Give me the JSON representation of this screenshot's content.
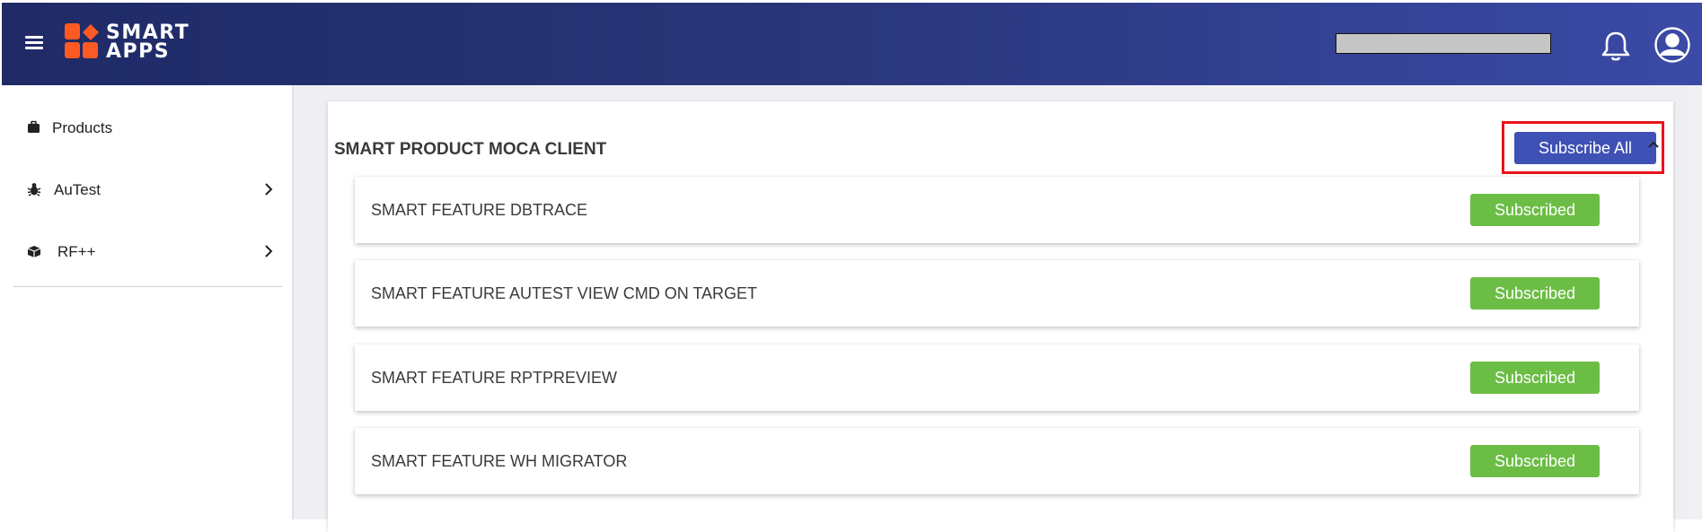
{
  "header": {
    "logo_line1": "SMART",
    "logo_line2": "APPS",
    "search_value": ""
  },
  "sidebar": {
    "items": [
      {
        "label": "Products",
        "icon": "briefcase-icon",
        "has_chevron": false
      },
      {
        "label": "AuTest",
        "icon": "bug-icon",
        "has_chevron": true
      },
      {
        "label": "RF++",
        "icon": "box-icon",
        "has_chevron": true
      }
    ]
  },
  "main": {
    "product_title": "SMART PRODUCT MOCA CLIENT",
    "subscribe_all_label": "Subscribe All",
    "features": [
      {
        "name": "SMART FEATURE DBTRACE",
        "status": "Subscribed"
      },
      {
        "name": "SMART FEATURE AUTEST VIEW CMD ON TARGET",
        "status": "Subscribed"
      },
      {
        "name": "SMART FEATURE RPTPREVIEW",
        "status": "Subscribed"
      },
      {
        "name": "SMART FEATURE WH MIGRATOR",
        "status": "Subscribed"
      }
    ]
  },
  "colors": {
    "header_gradient_start": "#1f2a66",
    "header_gradient_end": "#3a4aa6",
    "logo_orange": "#ff5a23",
    "subscribe_all_blue": "#3f51b5",
    "subscribed_green": "#6cbd45",
    "highlight_red": "#e8141b"
  }
}
